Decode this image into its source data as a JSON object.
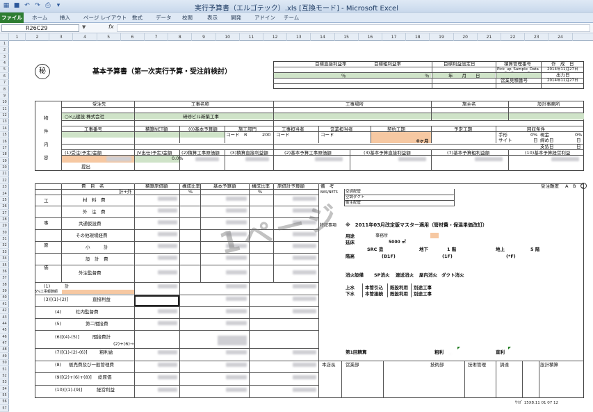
{
  "window": {
    "title": "実行予算書（エルゴテック）.xls  [互換モード] - Microsoft Excel"
  },
  "ribbon": {
    "tabs": [
      "ファイル",
      "ホーム",
      "挿入",
      "ページ レイアウト",
      "数式",
      "データ",
      "校閲",
      "表示",
      "開発",
      "アドイン",
      "チーム"
    ]
  },
  "formula_bar": {
    "name_box": "R26C29",
    "fx": "fx"
  },
  "columns": [
    "1",
    "2",
    "3",
    "4",
    "5",
    "6",
    "7",
    "8",
    "9",
    "10",
    "11",
    "12",
    "13",
    "14",
    "15",
    "16",
    "17",
    "18",
    "19",
    "20",
    "21",
    "22",
    "23",
    "24"
  ],
  "rows": [
    "1",
    "2",
    "3",
    "4",
    "5",
    "6",
    "7",
    "8",
    "9",
    "10",
    "11",
    "12",
    "13",
    "14",
    "15",
    "16",
    "17",
    "18",
    "19",
    "20",
    "21",
    "22",
    "23",
    "24",
    "25",
    "26",
    "27",
    "28",
    "29",
    "30",
    "31",
    "32",
    "33",
    "34",
    "35",
    "36",
    "37",
    "38",
    "39",
    "40",
    "41",
    "42",
    "43",
    "44",
    "45",
    "46",
    "47",
    "48",
    "49",
    "50",
    "51",
    "52",
    "53",
    "54",
    "55",
    "56",
    "57"
  ],
  "sheet": {
    "seal": "秘",
    "title": "基本予算書（第一次実行予算・受注前検討）",
    "hdr": {
      "target_rate": "目標直接利益率",
      "target_profit": "目標粗利益率",
      "target_date": "目標利益設定日",
      "mgr_no": "積算管理番号",
      "creator": "作　成　日",
      "yen1": "％",
      "yen2": "％",
      "ymd": "年　　月　　日",
      "pick": "Pick_up_Sample_Data",
      "date1": "2014年11月27日",
      "sales_no": "営業見積番号",
      "print_date": "出力日",
      "date2": "2014年11月27日"
    },
    "prop": {
      "label": [
        "物",
        "件",
        "内",
        "容"
      ],
      "client": "受注先",
      "project": "工事名称",
      "site": "工事場所",
      "owner": "施主名",
      "designer": "設計事務所",
      "client_v": "○×△建設 株式会社",
      "project_v": "研修ビル新築工事",
      "koji_no": "工事番号",
      "net": "積算NET額",
      "base_budget": "(0)基本予算額",
      "dept": "施工部門",
      "koji_tanto": "工事担当者",
      "eigyo_tanto": "営業担当者",
      "keiyaku": "契約工期",
      "yotei": "予定工期",
      "kaishu": "回収条件",
      "code1": "コード　R",
      "code1v": "200",
      "code2": "コード",
      "code3": "コード",
      "months": "0ヶ月",
      "tegata": "手形",
      "tegata_v": "0%",
      "genkin": "現金",
      "genkin_v": "0%",
      "site_lbl": "サイト",
      "site_u": "日",
      "shime": "締め日",
      "shime_u": "日",
      "shiharai": "支払日",
      "shiharai_u": "日",
      "c1": "(1)受注(予定)金額",
      "c2": "JV出仕(予定)金額",
      "c3": "(2)積算工事原価額",
      "c4": "(3)積算直接利益額",
      "c5": "(2)基本予算工事原価額",
      "c6": "(3)基本予算直接利益額",
      "c7": "(7)基本予算粗利益額",
      "c8": "(10)基本予算経営利益",
      "jv_rate": "0.0%",
      "teishutsu": "提出"
    },
    "cost": {
      "label": [
        "工",
        "事",
        "原",
        "価"
      ],
      "h_item": "費　目　名",
      "h_sub": "計+外",
      "h1": "積算原価額",
      "h2": "構成比率",
      "h2u": "%",
      "h3": "基本予算額",
      "h4": "構成比率",
      "h4u": "%",
      "h5": "原価計予算額",
      "h6": "備　考",
      "items": [
        "材　料　費",
        "外　注　費",
        "共通仮設費",
        "その他現場経費",
        "小　　　計",
        "設　計　費",
        "外注監督費"
      ],
      "r1": "(1)",
      "r1b": "計",
      "r1note": "5%工事報酬額",
      "r2": "(3)[(1)-(2)]",
      "r2b": "直接利益",
      "r3": "(4)",
      "r3b": "社内監督費",
      "r4": "(5)",
      "r4b": "第二間接費",
      "r5": "(6)[(4)-(5)]",
      "r5b": "間接費計",
      "r5c": "(2)+(6)→",
      "r6": "(7)[(1)-(2)-(6)]",
      "r6b": "粗利益",
      "r7": "(8)",
      "r7b": "販売費及び一般管理費",
      "r8": "(9)[(2)+(6)+(8)]",
      "r8b": "総原価",
      "r9": "(10)[(1)-(9)]",
      "r9b": "経営利益"
    },
    "notes": {
      "ju_keido": "受注難度",
      "abc": "A　B　C",
      "base_tag": "BAS/NETS",
      "n1": "空調配管",
      "n2": "空調ダクト",
      "n3": "衛生配管",
      "tokki": "特記事項",
      "tokki_v": "※　2011年03月改定版マスター適用（管材費・保温単価改訂）",
      "youto": "用途",
      "youto_v": "事務所",
      "menseki": "延床",
      "menseki_v": "5000 ㎡",
      "kozo": "SRC 造",
      "chika": "地下",
      "chika_v": "1 階",
      "chijo": "地上",
      "chijo_v": "5 階",
      "torikai": "階高",
      "bf": "(B1F)",
      "f1": "(1F)",
      "fx": "(*F)",
      "sh1": "消火設備",
      "sh2": "SP消火",
      "sh3": "連送消火",
      "sh4": "屋内消火",
      "sh5": "ダクト消火",
      "jo": "上水",
      "jo1": "本管引込",
      "jo2": "既設利用",
      "jo3": "別途工事",
      "ge": "下水",
      "ge1": "本管接続",
      "ge2": "既設利用",
      "ge3": "別途工事",
      "bikou1": "第1回精算",
      "arari": "粗利",
      "keiri": "直利",
      "s1": "本店長",
      "s2": "営業部",
      "s3": "技術部",
      "s4": "技術管理",
      "s5": "調達",
      "s6": "設計積算",
      "footer": "ｻｲｽﾞ 15X8.11  01 07 12"
    }
  }
}
